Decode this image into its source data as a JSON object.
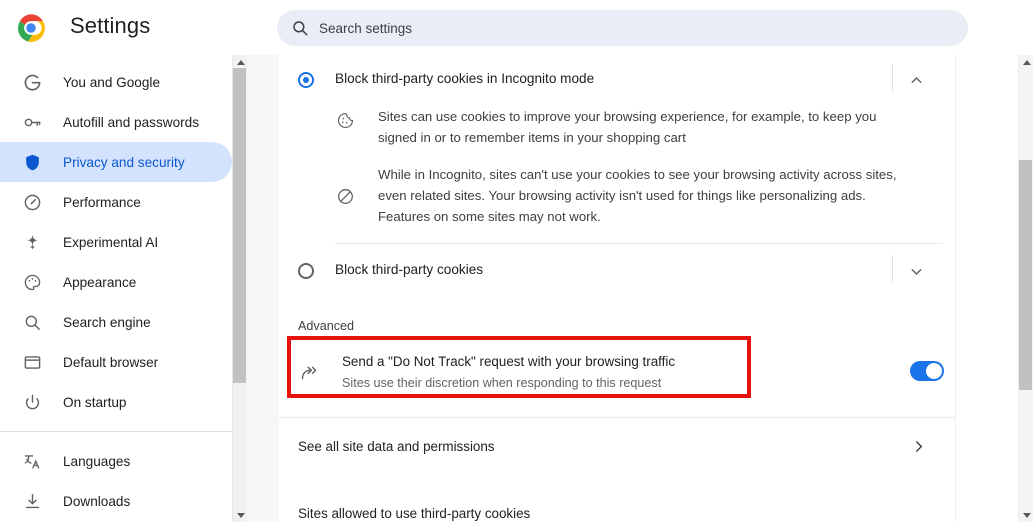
{
  "header": {
    "logo_icon": "chrome-logo-icon",
    "title": "Settings",
    "search": {
      "icon": "search-icon",
      "placeholder": "Search settings",
      "value": ""
    }
  },
  "sidebar": {
    "items": [
      {
        "label": "You and Google",
        "icon": "google-g-icon",
        "selected": false
      },
      {
        "label": "Autofill and passwords",
        "icon": "key-icon",
        "selected": false
      },
      {
        "label": "Privacy and security",
        "icon": "shield-icon",
        "selected": true
      },
      {
        "label": "Performance",
        "icon": "speedometer-icon",
        "selected": false
      },
      {
        "label": "Experimental AI",
        "icon": "sparkle-icon",
        "selected": false
      },
      {
        "label": "Appearance",
        "icon": "palette-icon",
        "selected": false
      },
      {
        "label": "Search engine",
        "icon": "magnifier-icon",
        "selected": false
      },
      {
        "label": "Default browser",
        "icon": "browser-window-icon",
        "selected": false
      },
      {
        "label": "On startup",
        "icon": "power-icon",
        "selected": false
      }
    ],
    "items_after_divider": [
      {
        "label": "Languages",
        "icon": "translate-icon",
        "selected": false
      },
      {
        "label": "Downloads",
        "icon": "download-icon",
        "selected": false
      }
    ],
    "scrollbar": {
      "up_arrow_icon": "scroll-up-arrow-icon",
      "down_arrow_icon": "scroll-down-arrow-icon"
    }
  },
  "main": {
    "options": [
      {
        "label": "Block third-party cookies in Incognito mode",
        "selected": true,
        "chevron_icon": "chevron-up-icon",
        "descriptions": [
          {
            "icon": "cookie-icon",
            "text": "Sites can use cookies to improve your browsing experience, for example, to keep you signed in or to remember items in your shopping cart"
          },
          {
            "icon": "block-circle-slash-icon",
            "text": "While in Incognito, sites can't use your cookies to see your browsing activity across sites, even related sites. Your browsing activity isn't used for things like personalizing ads. Features on some sites may not work."
          }
        ]
      },
      {
        "label": "Block third-party cookies",
        "selected": false,
        "chevron_icon": "chevron-down-icon",
        "descriptions": []
      }
    ],
    "advanced_label": "Advanced",
    "do_not_track": {
      "icon": "do-not-track-arrow-icon",
      "title": "Send a \"Do Not Track\" request with your browsing traffic",
      "subtitle": "Sites use their discretion when responding to this request",
      "toggle_on": true,
      "highlight_color": "#e8130e"
    },
    "site_data_link": {
      "label": "See all site data and permissions",
      "chevron_icon": "chevron-right-icon"
    },
    "bottom_section_label": "Sites allowed to use third-party cookies",
    "scrollbar": {
      "up_arrow_icon": "scroll-up-arrow-icon",
      "down_arrow_icon": "scroll-down-arrow-icon"
    }
  },
  "colors": {
    "accent_blue": "#1a73e8",
    "selected_nav_bg": "#d3e3fd",
    "selected_nav_text": "#0b57d0",
    "highlight_red": "#e8130e",
    "search_bg": "#e9edf5"
  }
}
